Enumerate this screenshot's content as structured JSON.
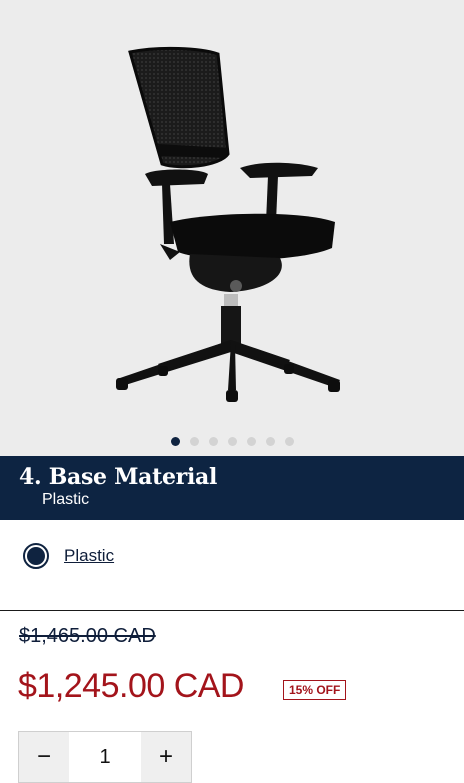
{
  "gallery": {
    "image_name": "office-chair-image",
    "dots_total": 7,
    "active_index": 0
  },
  "step": {
    "title": "4. Base Material",
    "selected_value": "Plastic"
  },
  "options": [
    {
      "label": "Plastic",
      "selected": true
    }
  ],
  "price": {
    "original": "$1,465.00 CAD",
    "current": "$1,245.00 CAD",
    "discount_badge": "15% OFF"
  },
  "quantity": {
    "value": "1",
    "decrement_icon": "minus-icon",
    "increment_icon": "plus-icon"
  },
  "colors": {
    "navy": "#0d2442",
    "sale_red": "#a3141b",
    "hero_bg": "#ececec"
  }
}
